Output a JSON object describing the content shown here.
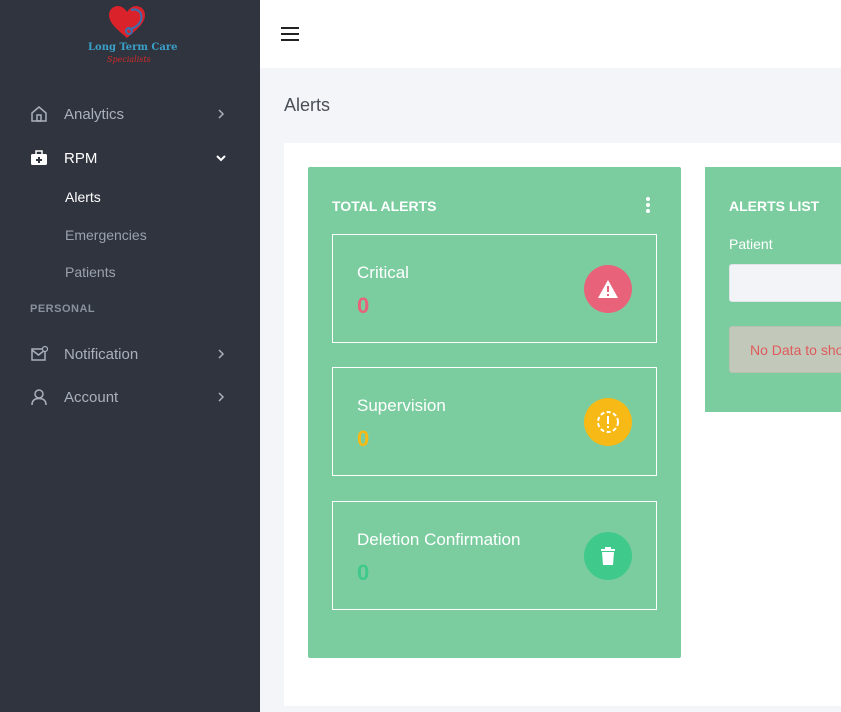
{
  "brand": {
    "line1": "Long Term Care",
    "line2": "Specialists"
  },
  "sidebar": {
    "items": [
      {
        "label": "Analytics",
        "icon": "home-icon"
      },
      {
        "label": "RPM",
        "icon": "medical-kit-icon"
      },
      {
        "label": "Notification",
        "icon": "mail-notification-icon"
      },
      {
        "label": "Account",
        "icon": "user-icon"
      }
    ],
    "rpm_subitems": [
      {
        "label": "Alerts",
        "active": true
      },
      {
        "label": "Emergencies",
        "active": false
      },
      {
        "label": "Patients",
        "active": false
      }
    ],
    "section_personal": "PERSONAL"
  },
  "page": {
    "title": "Alerts"
  },
  "total_alerts": {
    "title": "TOTAL ALERTS",
    "stats": [
      {
        "label": "Critical",
        "value": "0",
        "color": "#e8637a",
        "icon": "warning-icon"
      },
      {
        "label": "Supervision",
        "value": "0",
        "color": "#f7b916",
        "icon": "alert-circle-icon"
      },
      {
        "label": "Deletion Confirmation",
        "value": "0",
        "color": "#3fc98a",
        "icon": "trash-icon"
      }
    ]
  },
  "alerts_list": {
    "title": "ALERTS LIST",
    "patient_label": "Patient",
    "patient_value": "",
    "empty_message": "No Data to show"
  },
  "colors": {
    "sidebar_bg": "#30343f",
    "card_bg": "#7bcda0",
    "critical": "#e8637a",
    "supervision": "#f7b916",
    "deletion": "#3fc98a"
  }
}
